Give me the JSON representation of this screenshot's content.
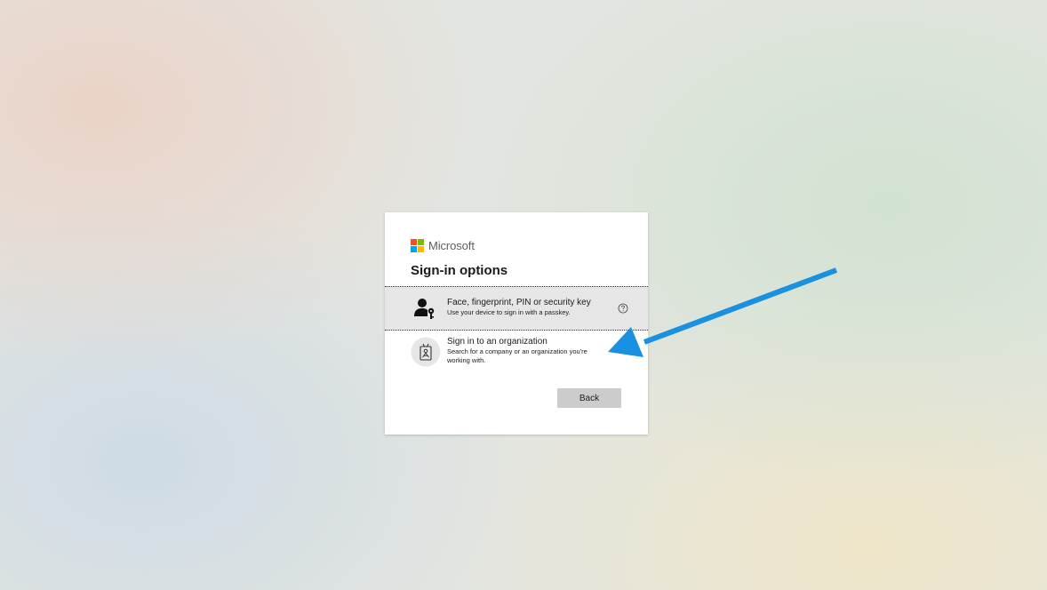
{
  "brand": {
    "name": "Microsoft",
    "logo_colors": [
      "#f25022",
      "#7fba00",
      "#00a4ef",
      "#ffb900"
    ]
  },
  "dialog": {
    "title": "Sign-in options",
    "options": [
      {
        "title": "Face, fingerprint, PIN or security key",
        "description": "Use your device to sign in with a passkey.",
        "icon": "person-key-icon",
        "help_icon": "help-circle-icon"
      },
      {
        "title": "Sign in to an organization",
        "description": "Search for a company or an organization you're working with.",
        "icon": "badge-icon"
      }
    ],
    "back_label": "Back"
  },
  "annotation": {
    "arrow_color": "#1a90e0",
    "arrow_direction": "pointing-left-at-organization-option"
  }
}
